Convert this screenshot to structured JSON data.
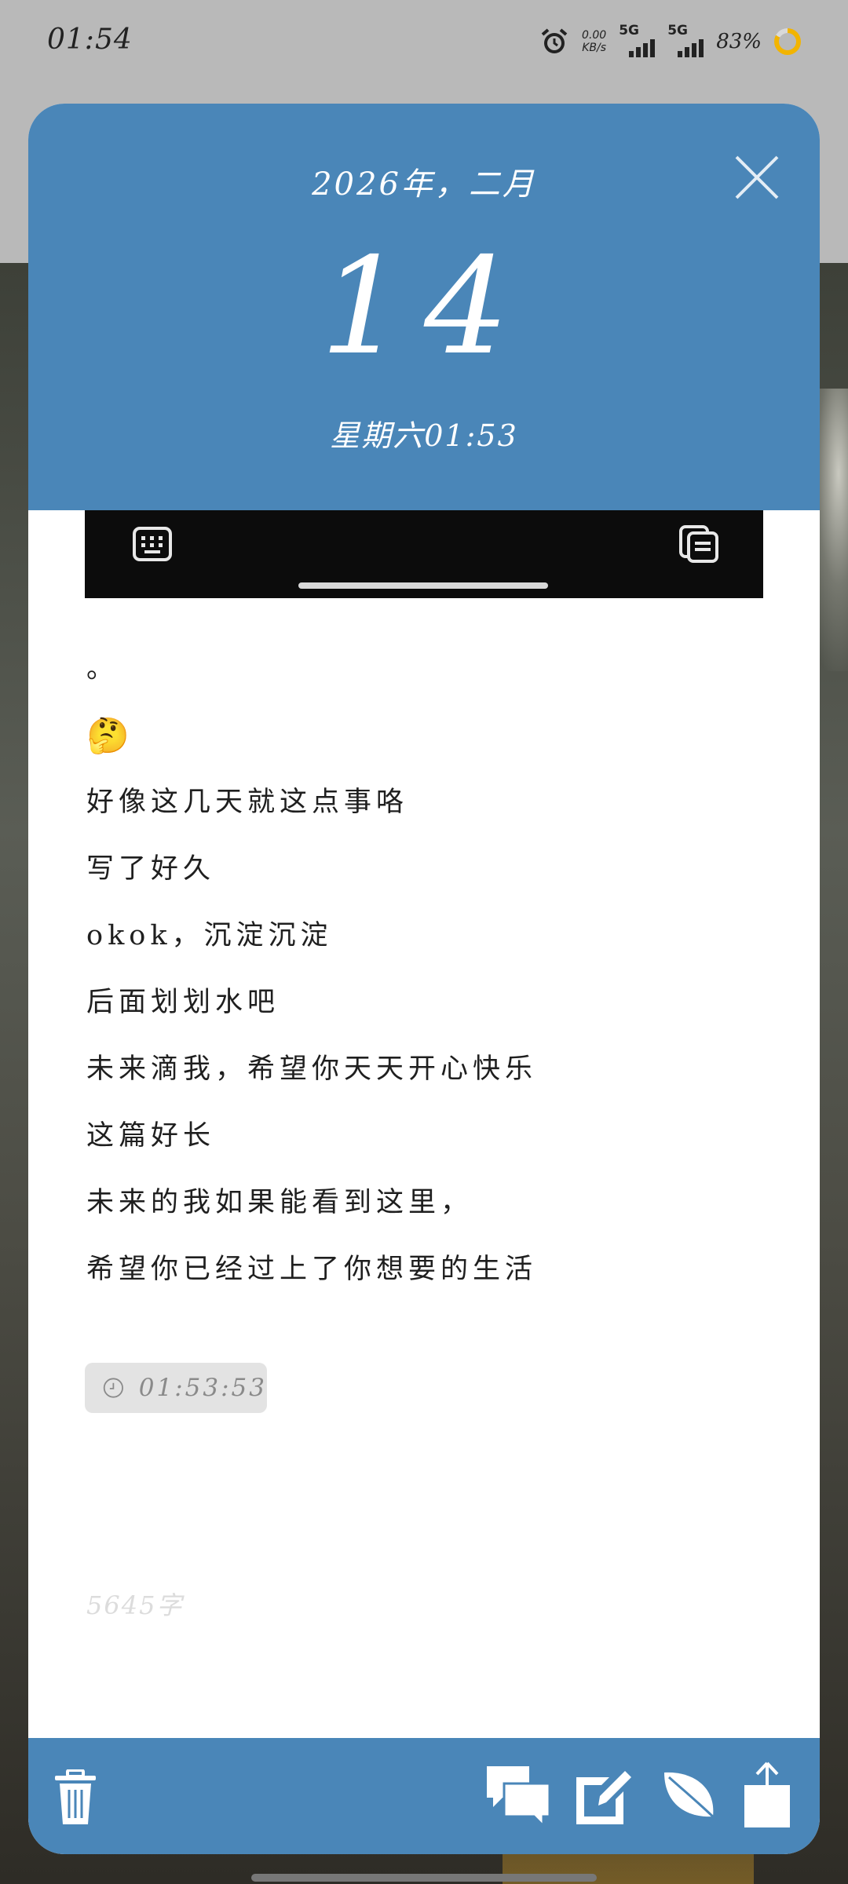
{
  "status_bar": {
    "time": "01:54",
    "net_speed_value": "0.00",
    "net_speed_unit": "KB/s",
    "sim1_label": "5G",
    "sim2_label": "5G",
    "battery_percent": "83%",
    "battery_level": 0.83,
    "icons": [
      "alarm-icon",
      "signal-icon",
      "signal-icon",
      "battery-ring-icon"
    ]
  },
  "header": {
    "month_title": "2026年，二月",
    "day": "14",
    "weekday_time": "星期六01:53",
    "close_icon": "close-icon"
  },
  "embedded_image": {
    "left_icon": "keyboard-icon",
    "right_icon": "clipboard-icon"
  },
  "entry": {
    "lines": [
      "。",
      "🤔",
      "好像这几天就这点事咯",
      "写了好久",
      "okok，沉淀沉淀",
      "后面划划水吧",
      "未来滴我，希望你天天开心快乐",
      "这篇好长",
      "未来的我如果能看到这里，",
      "希望你已经过上了你想要的生活"
    ],
    "timestamp": "01:53:53",
    "word_count": "5645字"
  },
  "toolbar": {
    "icons": [
      "trash-icon",
      "chat-icon",
      "edit-icon",
      "leaf-icon",
      "share-icon"
    ]
  },
  "colors": {
    "accent": "#4a86b8",
    "card": "#ffffff",
    "chip": "#e3e3e3",
    "battery": "#f2b400"
  }
}
